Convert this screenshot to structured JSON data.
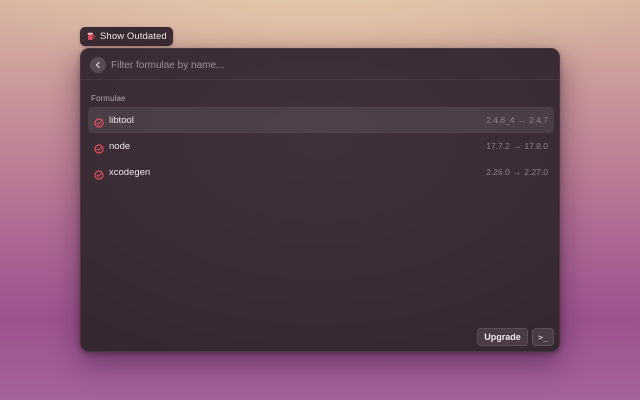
{
  "command_tag": {
    "label": "Show Outdated",
    "icon": "beer-mug-icon",
    "icon_color": "#e0525e"
  },
  "search": {
    "placeholder": "Filter formulae by name...",
    "value": "",
    "back_icon": "chevron-left-icon"
  },
  "section": {
    "title": "Formulae"
  },
  "formulae": [
    {
      "name": "libtool",
      "current": "2.4.6_4",
      "arrow": "→",
      "latest": "2.4.7",
      "selected": true
    },
    {
      "name": "node",
      "current": "17.7.2",
      "arrow": "→",
      "latest": "17.8.0",
      "selected": false
    },
    {
      "name": "xcodegen",
      "current": "2.26.0",
      "arrow": "→",
      "latest": "2.27.0",
      "selected": false
    }
  ],
  "item_icon": "check-circle-icon",
  "item_icon_color": "#e0525e",
  "footer": {
    "upgrade_label": "Upgrade",
    "terminal_label": ">_",
    "terminal_icon": "terminal-icon"
  }
}
